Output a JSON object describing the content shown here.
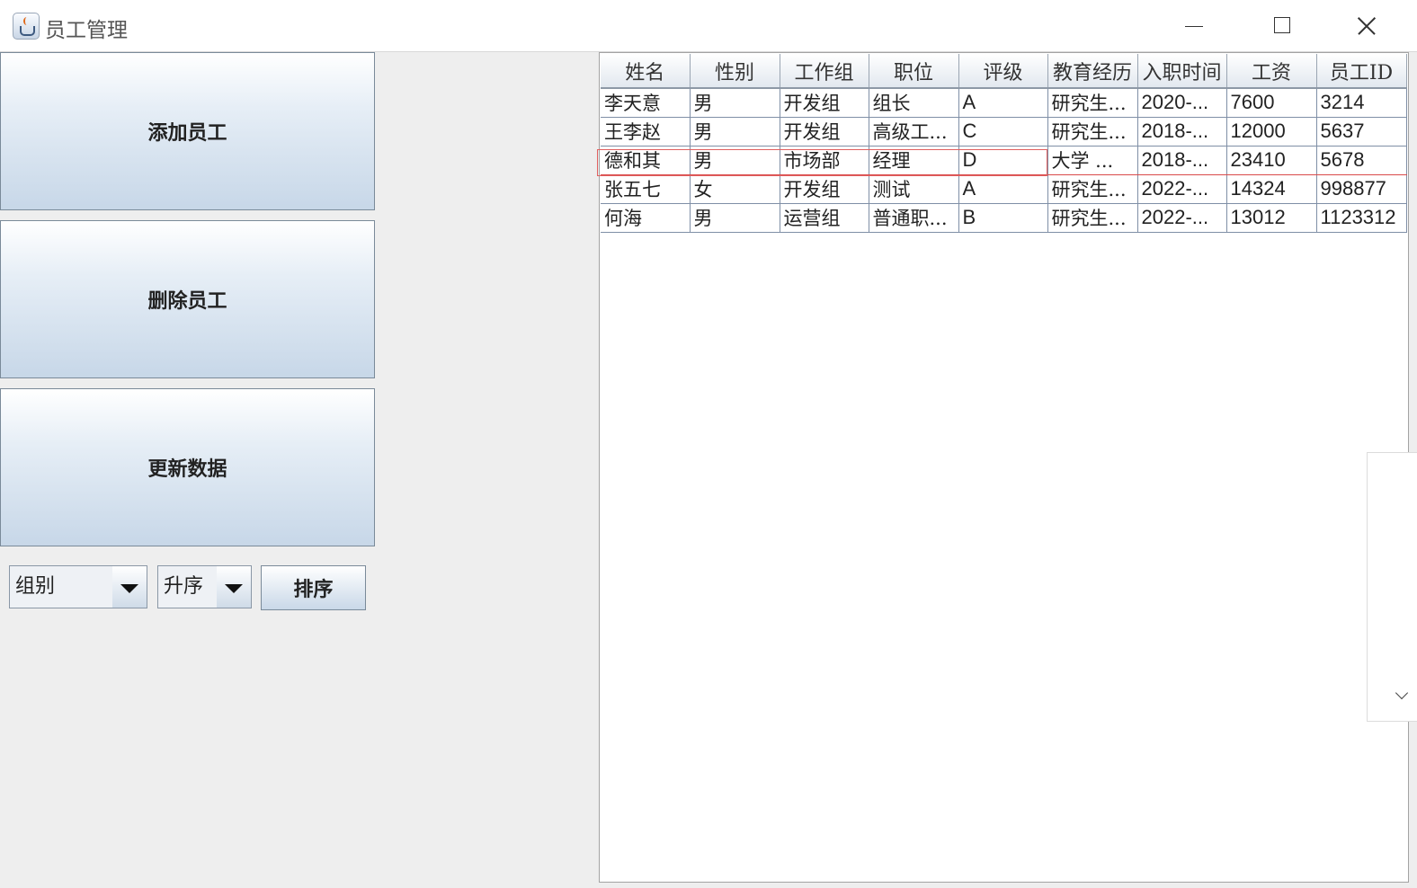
{
  "window": {
    "title": "员工管理",
    "controls": [
      "minimize",
      "maximize",
      "close"
    ]
  },
  "sidebar": {
    "add_button": "添加员工",
    "delete_button": "删除员工",
    "refresh_button": "更新数据"
  },
  "sort_bar": {
    "field_select": "组别",
    "order_select": "升序",
    "sort_button": "排序"
  },
  "table": {
    "columns": [
      "姓名",
      "性别",
      "工作组",
      "职位",
      "评级",
      "教育经历",
      "入职时间",
      "工资",
      "员工ID"
    ],
    "rows": [
      [
        "李天意",
        "男",
        "开发组",
        "组长",
        "A",
        "研究生...",
        "2020-...",
        "7600",
        "3214"
      ],
      [
        "王李赵",
        "男",
        "开发组",
        "高级工...",
        "C",
        "研究生...",
        "2018-...",
        "12000",
        "5637"
      ],
      [
        "德和其",
        "男",
        "市场部",
        "经理",
        "D",
        "大学   ...",
        "2018-...",
        "23410",
        "5678"
      ],
      [
        "张五七",
        "女",
        "开发组",
        "测试",
        "A",
        "研究生...",
        "2022-...",
        "14324",
        "998877"
      ],
      [
        "何海",
        "男",
        "运营组",
        "普通职...",
        "B",
        "研究生...",
        "2022-...",
        "13012",
        "1123312"
      ]
    ],
    "selected_row": 2
  },
  "colors": {
    "button_gradient_top": "#ffffff",
    "button_gradient_bottom": "#c7d7e8",
    "selection_border": "#e06060",
    "background": "#eeeeee"
  },
  "icons": {
    "app": "java-cup-icon",
    "expand": "chevron-down-icon"
  }
}
